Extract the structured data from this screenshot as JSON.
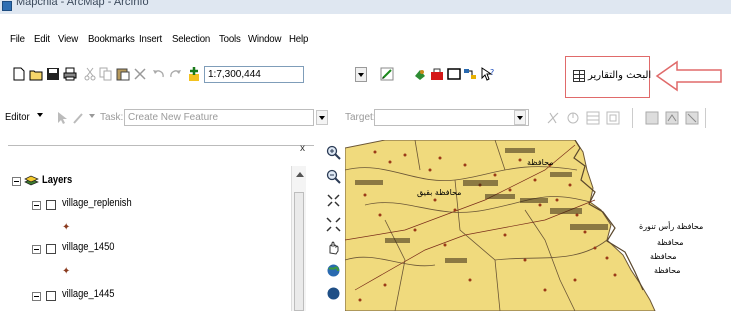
{
  "window": {
    "title": "Mapchia - ArcMap - ArcInfo",
    "icon": "arcmap-app-icon"
  },
  "menu": {
    "items": [
      "File",
      "Edit",
      "View",
      "Bookmarks",
      "Insert",
      "Selection",
      "Tools",
      "Window",
      "Help"
    ]
  },
  "standard_toolbar": {
    "scale_value": "1:7,300,444",
    "icons": [
      "new-doc-icon",
      "open-folder-icon",
      "save-icon",
      "print-icon",
      "cut-icon",
      "copy-icon",
      "paste-icon",
      "delete-icon",
      "undo-icon",
      "redo-icon",
      "add-data-icon",
      "editor-toolbar-icon",
      "catalog-icon",
      "arctoolbox-icon",
      "python-icon",
      "model-builder-icon",
      "whats-this-icon"
    ]
  },
  "custom_button": {
    "label": "البحث والتقارير",
    "icon": "table-icon",
    "highlight_color": "#e06a6a"
  },
  "annotation_arrow": {
    "color": "#e06a6a"
  },
  "editor_toolbar": {
    "editor_label": "Editor",
    "task_label": "Task:",
    "task_value": "Create New Feature",
    "target_label": "Target:",
    "target_value": ""
  },
  "toc": {
    "root_label": "Layers",
    "layers": [
      {
        "name": "village_replenish"
      },
      {
        "name": "village_1450"
      },
      {
        "name": "village_1445"
      }
    ]
  },
  "map_labels": [
    "محافظة رأس تنورة",
    "محافظة",
    "محافظة",
    "محافظة",
    "محافظة",
    "محافظة بقيق"
  ],
  "colors": {
    "map_fill": "#f0da7d",
    "map_border": "#6b5636",
    "village_marker": "#9b3a18",
    "water": "#ffffff"
  }
}
